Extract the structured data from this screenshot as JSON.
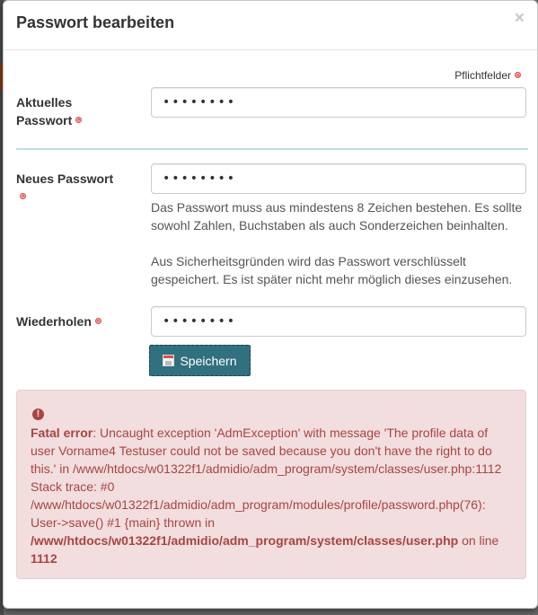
{
  "modal": {
    "title": "Passwort bearbeiten",
    "close_label": "×",
    "required_legend": "Pflichtfelder"
  },
  "fields": {
    "current": {
      "label_line1": "Aktuelles",
      "label_line2": "Passwort",
      "value": "••••••••"
    },
    "new": {
      "label": "Neues Passwort",
      "value": "••••••••",
      "help_1": "Das Passwort muss aus mindestens 8 Zeichen bestehen. Es sollte sowohl Zahlen, Buchstaben als auch Sonderzeichen beinhalten.",
      "help_2": "Aus Sicherheitsgründen wird das Passwort verschlüsselt gespeichert. Es ist später nicht mehr möglich dieses einzusehen."
    },
    "repeat": {
      "label": "Wiederholen",
      "value": "••••••••"
    }
  },
  "save_button": {
    "label": "Speichern",
    "icon": "floppy-disk-icon"
  },
  "error": {
    "icon": "exclamation-circle-icon",
    "title": "Fatal error",
    "message": ": Uncaught exception 'AdmException' with message 'The profile data of user Vorname4 Testuser could not be saved because you don't have the right to do this.' in /www/htdocs/w01322f1/admidio/adm_program/system/classes/user.php:1112 Stack trace: #0 /www/htdocs/w01322f1/admidio/adm_program/modules/profile/password.php(76): User->save() #1 {main} thrown in ",
    "file": "/www/htdocs/w01322f1/admidio/adm_program/system/classes/user.php",
    "on_line": " on line ",
    "line": "1112"
  },
  "colors": {
    "button": "#31707f",
    "error_bg": "#f2dede",
    "error_text": "#a94442",
    "separator": "#bfdde6"
  }
}
